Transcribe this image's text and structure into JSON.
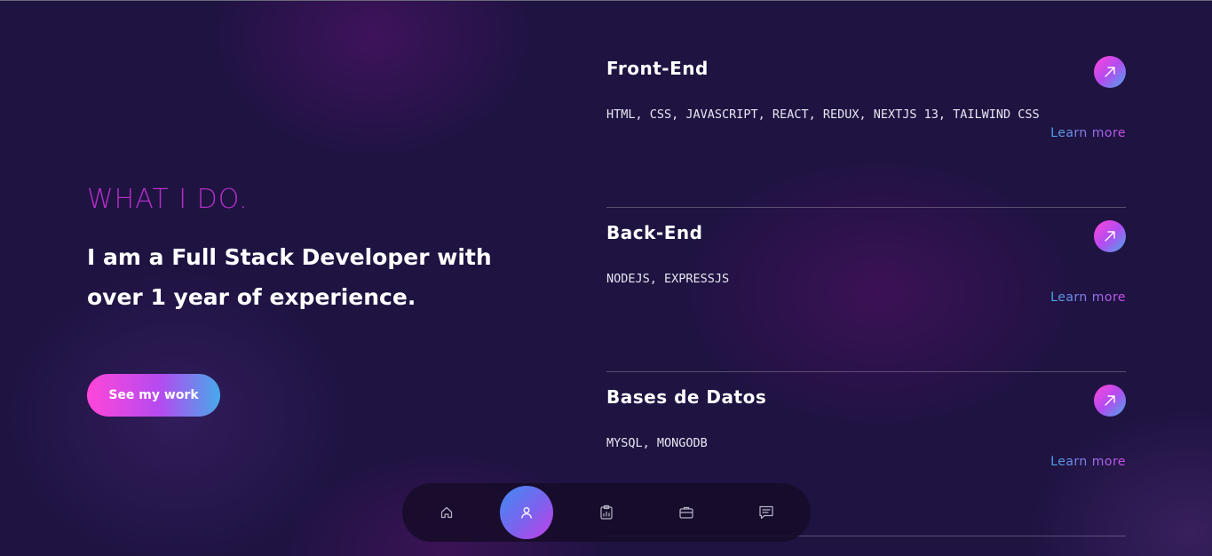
{
  "about": {
    "section_title": "WHAT I DO.",
    "intro": "I am a Full Stack Developer with over 1 year of experience.",
    "cta_label": "See my work"
  },
  "services": [
    {
      "title": "Front-End",
      "skills": "HTML, CSS, JAVASCRIPT, REACT, REDUX, NEXTJS 13, TAILWIND CSS",
      "link_label": "Learn more",
      "icon": "arrow-up-right-icon"
    },
    {
      "title": "Back-End",
      "skills": "NODEJS, EXPRESSJS",
      "link_label": "Learn more",
      "icon": "arrow-up-right-icon"
    },
    {
      "title": "Bases de Datos",
      "skills": "MYSQL, MONGODB",
      "link_label": "Learn more",
      "icon": "arrow-up-right-icon"
    }
  ],
  "nav": {
    "items": [
      {
        "icon": "home-icon",
        "active": false
      },
      {
        "icon": "user-icon",
        "active": true
      },
      {
        "icon": "clipboard-icon",
        "active": false
      },
      {
        "icon": "briefcase-icon",
        "active": false
      },
      {
        "icon": "message-icon",
        "active": false
      }
    ]
  },
  "colors": {
    "background": "#1f1342",
    "section_title": "#b32ec4",
    "gradient_pink": "#ff46d9",
    "gradient_purple": "#b44bf0",
    "gradient_blue": "#47a9ea",
    "nav_bg": "#160c28"
  }
}
